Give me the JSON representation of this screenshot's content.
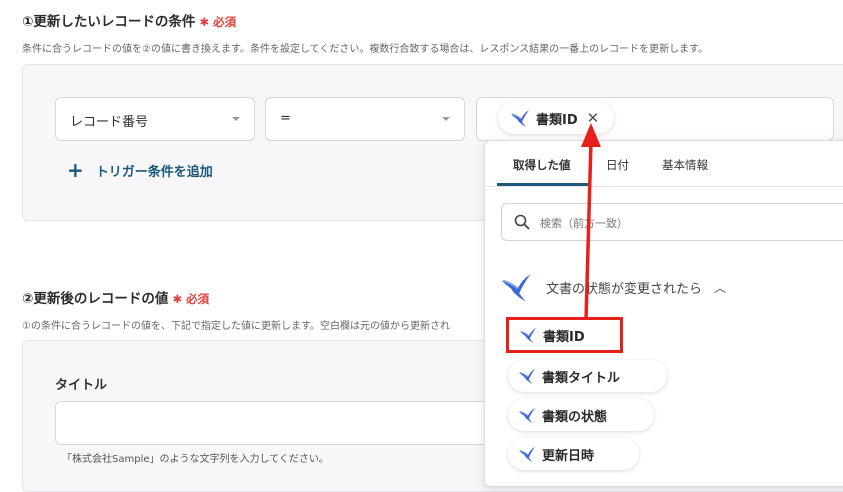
{
  "section1": {
    "title": "①更新したいレコードの条件",
    "required": "必須",
    "description": "条件に合うレコードの値を②の値に書き換えます。条件を設定してください。複数行合致する場合は、レスポンス結果の一番上のレコードを更新します。",
    "field_select": "レコード番号",
    "operator_select": "=",
    "value_chip": "書類ID",
    "add_condition": "トリガー条件を追加"
  },
  "section2": {
    "title": "②更新後のレコードの値",
    "required": "必須",
    "description": "①の条件に合うレコードの値を、下記で指定した値に更新します。空白欄は元の値から更新され",
    "field_label": "タイトル",
    "hint": "「株式会社Sample」のような文字列を入力してください。"
  },
  "dropdown": {
    "tabs": [
      "取得した値",
      "日付",
      "基本情報"
    ],
    "active_tab": 0,
    "search_placeholder": "検索（前方一致）",
    "group_label": "文書の状態が変更されたら",
    "items": [
      "書類ID",
      "書類タイトル",
      "書類の状態",
      "更新日時"
    ],
    "highlighted_item": 0
  },
  "colors": {
    "accent": "#1c5a7a",
    "required": "#e0403e",
    "highlight": "#e8201c",
    "icon_blue": "#3f66d6"
  }
}
